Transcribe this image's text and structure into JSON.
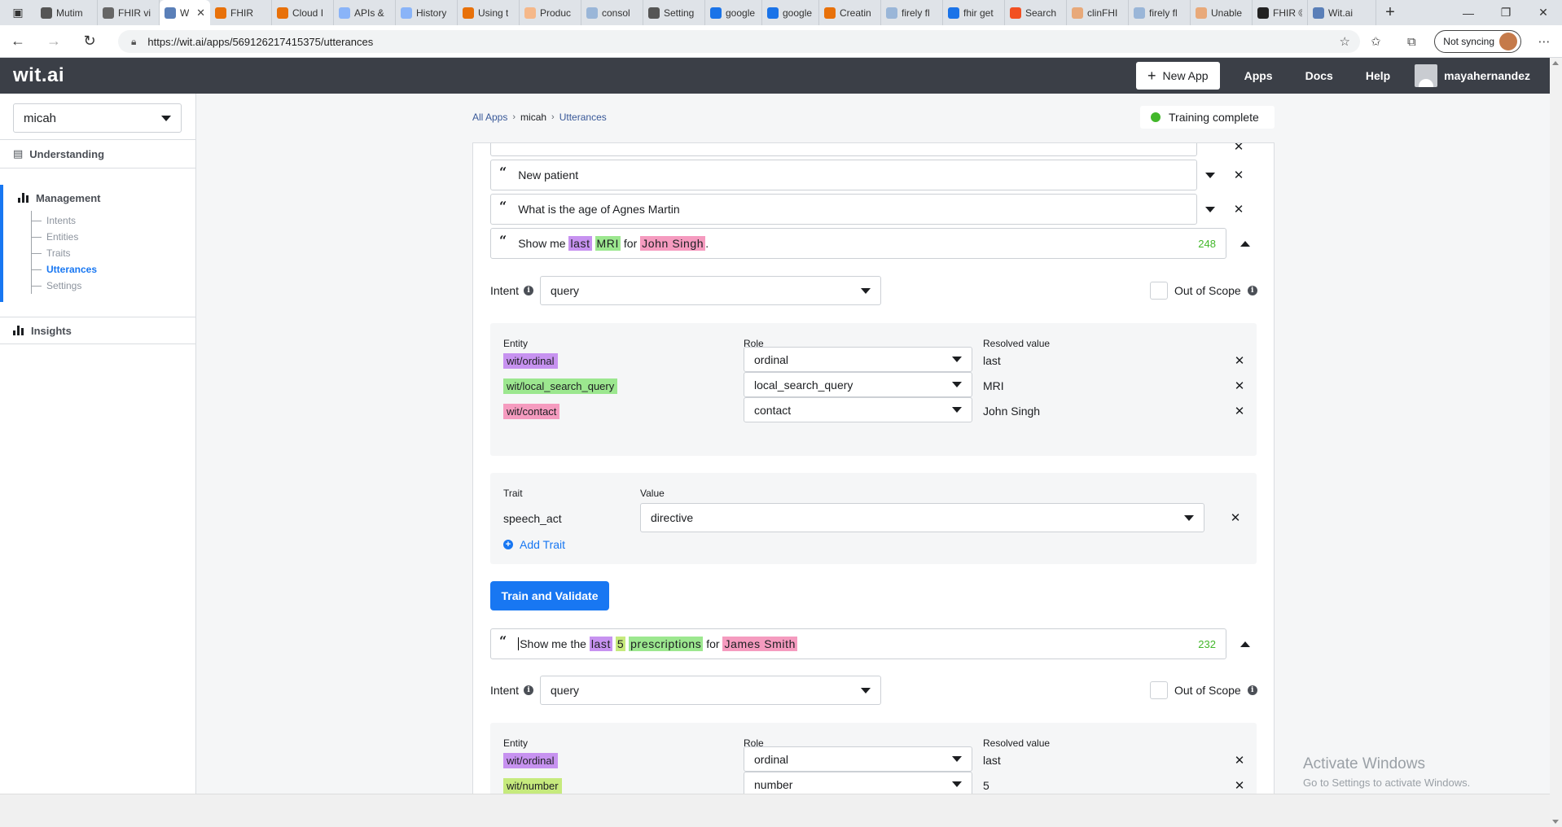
{
  "browser": {
    "tabs": [
      {
        "title": "Mutim",
        "color": "#555"
      },
      {
        "title": "FHIR vi",
        "color": "#666"
      },
      {
        "title": "Wi",
        "color": "#5a7fb8",
        "active": true
      },
      {
        "title": "FHIR",
        "color": "#e8710a"
      },
      {
        "title": "Cloud I",
        "color": "#e8710a"
      },
      {
        "title": "APIs &",
        "color": "#8ab4f8"
      },
      {
        "title": "History",
        "color": "#8ab4f8"
      },
      {
        "title": "Using t",
        "color": "#e8710a"
      },
      {
        "title": "Produc",
        "color": "#f5b88a"
      },
      {
        "title": "consol",
        "color": "#9ab6d8"
      },
      {
        "title": "Setting",
        "color": "#555"
      },
      {
        "title": "google",
        "color": "#1a73e8"
      },
      {
        "title": "google",
        "color": "#1a73e8"
      },
      {
        "title": "Creatin",
        "color": "#e8710a"
      },
      {
        "title": "firely fl",
        "color": "#9ab6d8"
      },
      {
        "title": "fhir get",
        "color": "#1a73e8"
      },
      {
        "title": "Search",
        "color": "#f25022"
      },
      {
        "title": "clinFHI",
        "color": "#e8a97a"
      },
      {
        "title": "firely fl",
        "color": "#9ab6d8"
      },
      {
        "title": "Unable",
        "color": "#e8a97a"
      },
      {
        "title": "FHIR ©",
        "color": "#222"
      },
      {
        "title": "Wit.ai",
        "color": "#5a7fb8"
      }
    ],
    "url": "https://wit.ai/apps/569126217415375/utterances",
    "sync_label": "Not syncing"
  },
  "header": {
    "logo": "wit.ai",
    "new_app_label": "New App",
    "links": [
      "Apps",
      "Docs",
      "Help"
    ],
    "username": "mayahernandez"
  },
  "sidebar": {
    "app_name": "micah",
    "understanding_label": "Understanding",
    "management_label": "Management",
    "management_items": [
      {
        "label": "Intents"
      },
      {
        "label": "Entities"
      },
      {
        "label": "Traits"
      },
      {
        "label": "Utterances",
        "active": true
      },
      {
        "label": "Settings"
      }
    ],
    "insights_label": "Insights"
  },
  "breadcrumb": {
    "all_apps": "All Apps",
    "app": "micah",
    "page": "Utterances"
  },
  "status": {
    "label": "Training complete",
    "color": "#42b72a"
  },
  "utterances_collapsed": [
    {
      "text": "New patient"
    },
    {
      "text": "What is the age of Agnes Martin"
    }
  ],
  "expanded_1": {
    "segments": [
      {
        "t": "Show me "
      },
      {
        "t": "last",
        "hl": "purple"
      },
      {
        "t": " "
      },
      {
        "t": "MRI",
        "hl": "green"
      },
      {
        "t": " for "
      },
      {
        "t": "John Singh",
        "hl": "pink"
      },
      {
        "t": "."
      }
    ],
    "count": "248",
    "intent_label": "Intent",
    "intent_value": "query",
    "out_of_scope": "Out of Scope",
    "headers": {
      "entity": "Entity",
      "role": "Role",
      "resolved": "Resolved value"
    },
    "entities": [
      {
        "entity": "wit/ordinal",
        "role": "ordinal",
        "value": "last",
        "hl": "purple"
      },
      {
        "entity": "wit/local_search_query",
        "role": "local_search_query",
        "value": "MRI",
        "hl": "green"
      },
      {
        "entity": "wit/contact",
        "role": "contact",
        "value": "John Singh",
        "hl": "pink"
      }
    ],
    "trait_headers": {
      "trait": "Trait",
      "value": "Value"
    },
    "trait": {
      "name": "speech_act",
      "value": "directive"
    },
    "add_trait": "Add Trait",
    "train_button": "Train and Validate"
  },
  "expanded_2": {
    "segments": [
      {
        "t": "Show me the "
      },
      {
        "t": "last",
        "hl": "purple"
      },
      {
        "t": " "
      },
      {
        "t": "5",
        "hl": "lime"
      },
      {
        "t": " "
      },
      {
        "t": "prescriptions",
        "hl": "green"
      },
      {
        "t": " for "
      },
      {
        "t": "James Smith",
        "hl": "pink"
      }
    ],
    "count": "232",
    "intent_label": "Intent",
    "intent_value": "query",
    "out_of_scope": "Out of Scope",
    "headers": {
      "entity": "Entity",
      "role": "Role",
      "resolved": "Resolved value"
    },
    "entities": [
      {
        "entity": "wit/ordinal",
        "role": "ordinal",
        "value": "last",
        "hl": "purple"
      },
      {
        "entity": "wit/number",
        "role": "number",
        "value": "5",
        "hl": "lime"
      }
    ]
  },
  "watermark": {
    "title": "Activate Windows",
    "subtitle": "Go to Settings to activate Windows."
  }
}
